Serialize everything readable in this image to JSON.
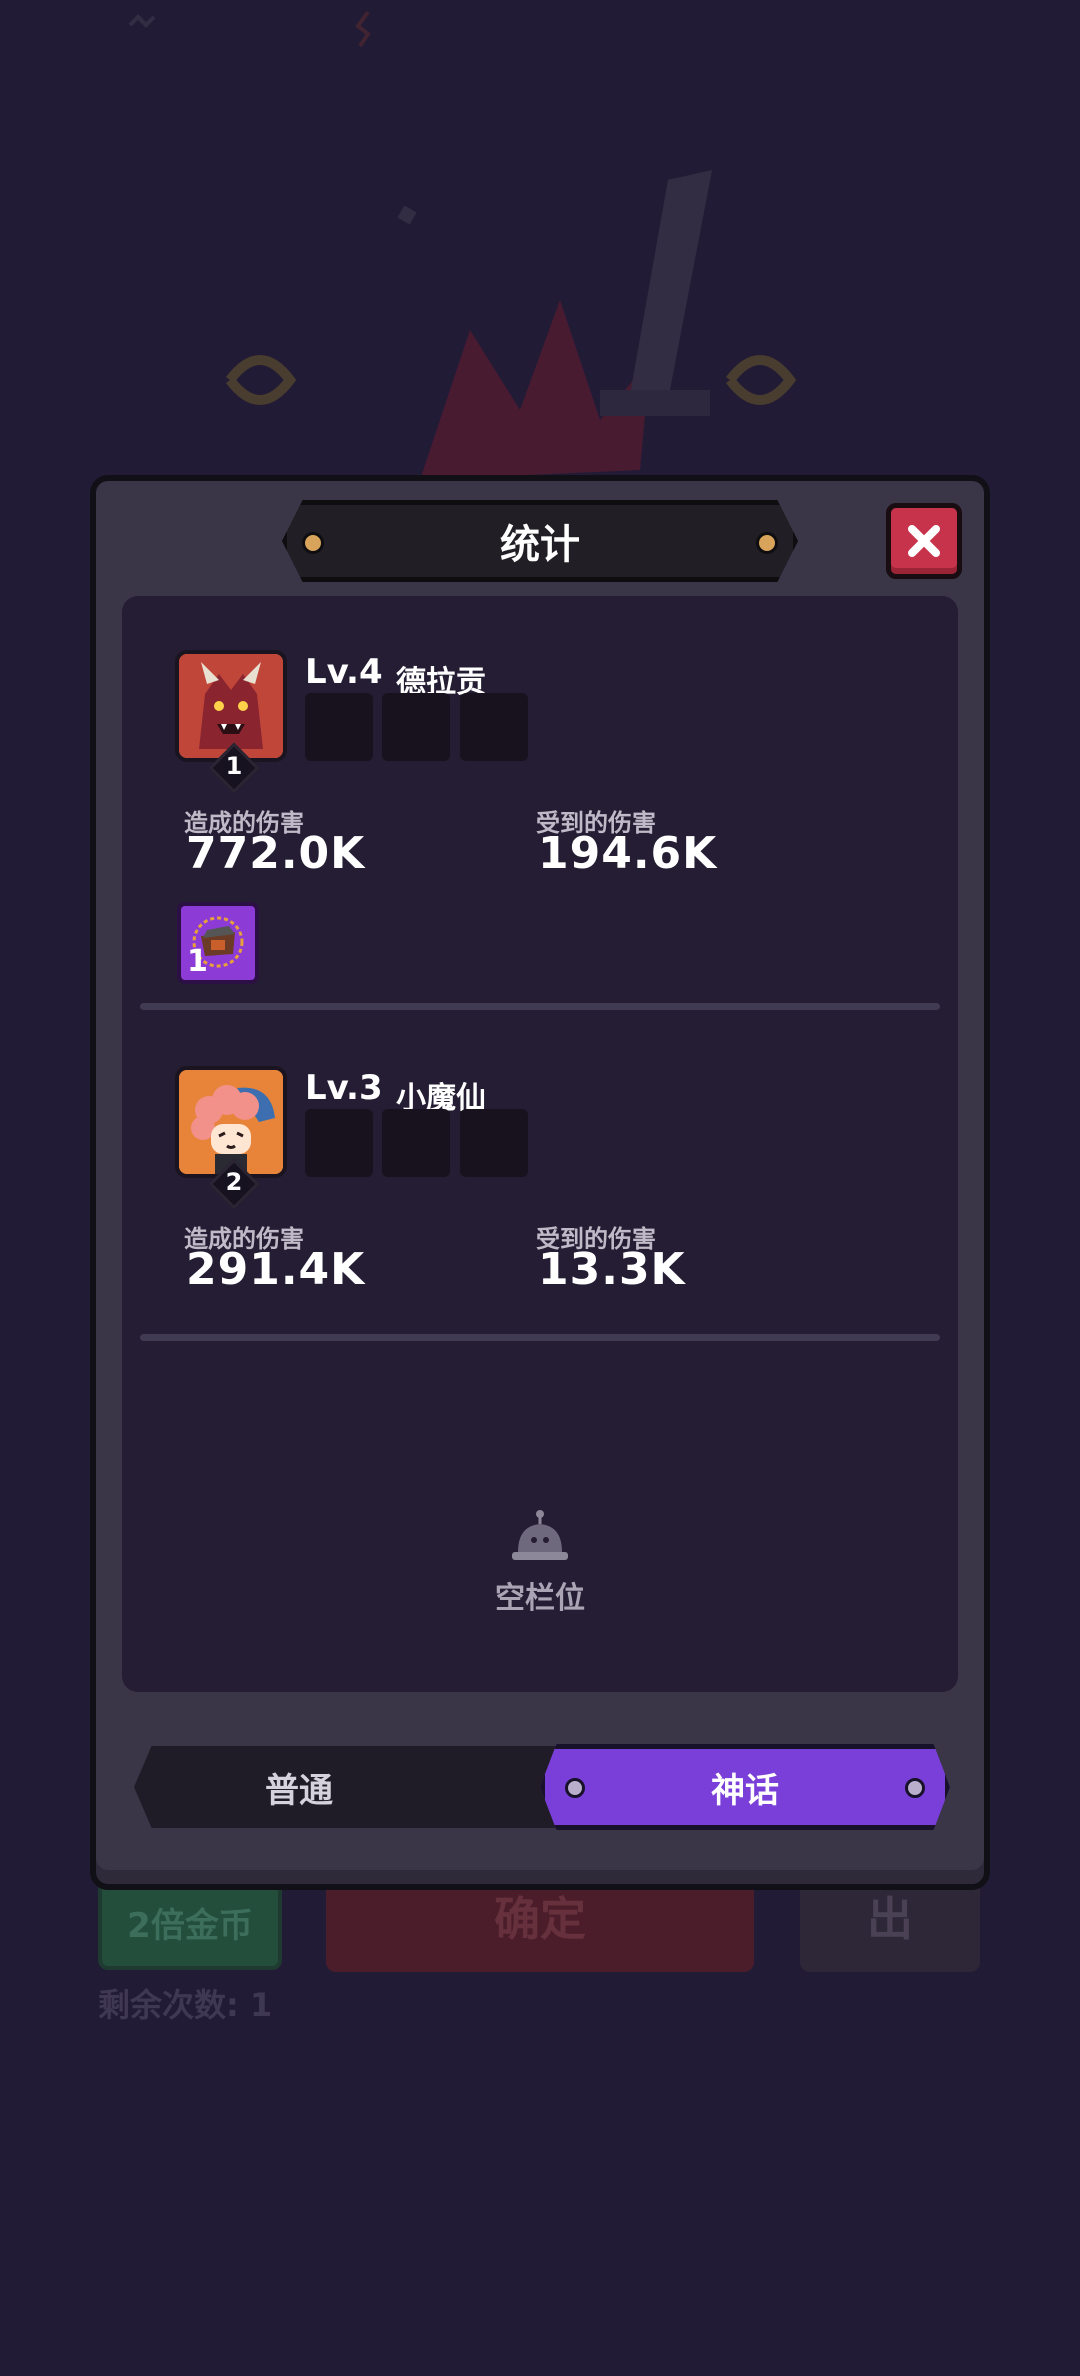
{
  "background": {
    "double_gold_label": "2倍金币",
    "confirm_label": "确定",
    "exit_label": "出",
    "remaining_label": "剩余次数: 1"
  },
  "dialog": {
    "title": "统计",
    "close_icon": "close-x-icon"
  },
  "heroes": [
    {
      "rank": "1",
      "level": "Lv.4",
      "name": "德拉贡",
      "portrait_icon": "red-dragon-demon-portrait",
      "damage_dealt_label": "造成的伤害",
      "damage_dealt": "772.0K",
      "damage_taken_label": "受到的伤害",
      "damage_taken": "194.6K",
      "item": {
        "icon": "purple-treasure-item-icon",
        "count": "1"
      }
    },
    {
      "rank": "2",
      "level": "Lv.3",
      "name": "小魔仙",
      "portrait_icon": "curly-hair-kid-portrait",
      "damage_dealt_label": "造成的伤害",
      "damage_dealt": "291.4K",
      "damage_taken_label": "受到的伤害",
      "damage_taken": "13.3K"
    }
  ],
  "empty_slot_label": "空栏位",
  "tabs": [
    {
      "label": "普通",
      "active": false
    },
    {
      "label": "神话",
      "active": true
    }
  ],
  "colors": {
    "accent_purple": "#7a3fd8",
    "close_red": "#c8334c",
    "hero_orange": "#e8833a",
    "item_purple": "#8c3bd6"
  }
}
